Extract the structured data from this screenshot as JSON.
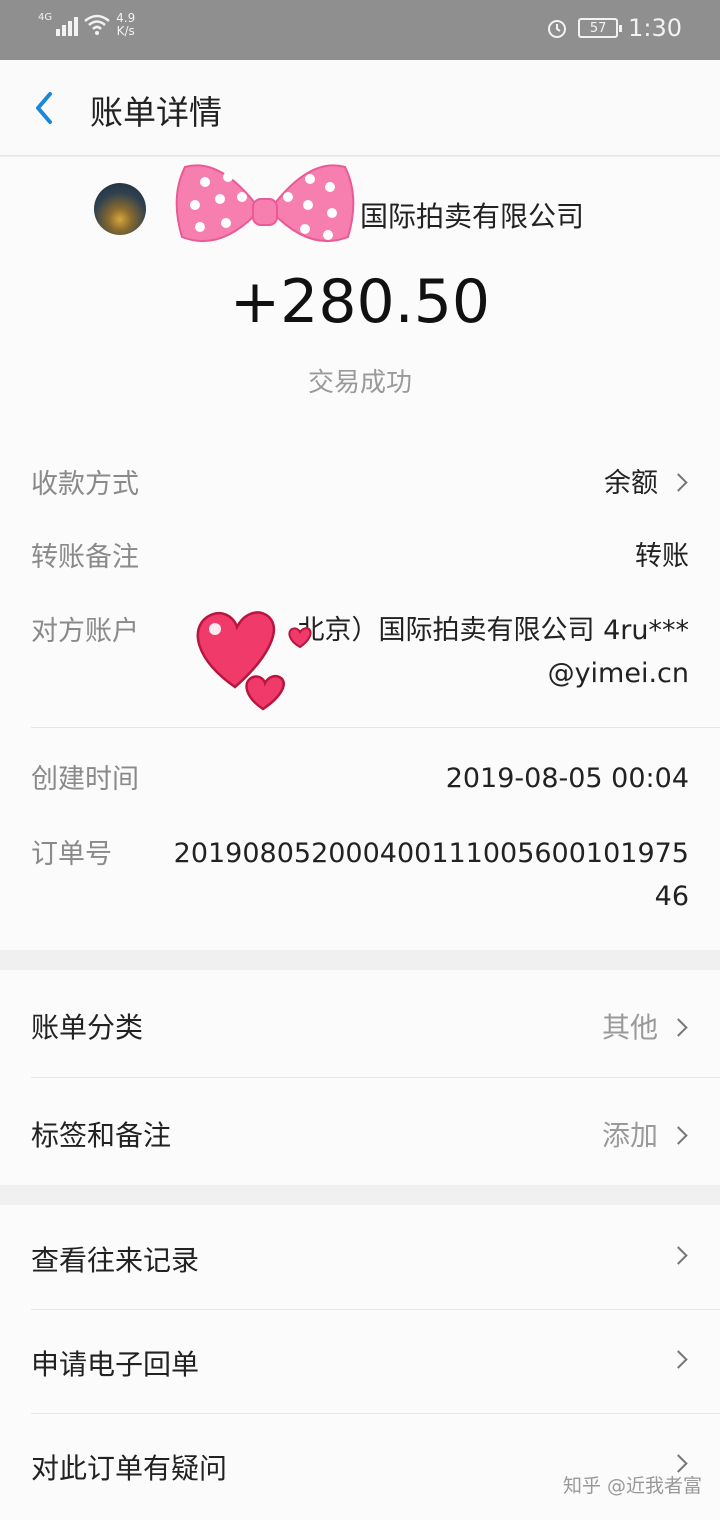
{
  "status_bar": {
    "network": "4G",
    "speed_value": "4.9",
    "speed_unit": "K/s",
    "battery": "57",
    "time": "1:30",
    "icons": [
      "signal-icon",
      "wifi-icon",
      "alarm-icon",
      "battery-icon"
    ]
  },
  "header": {
    "title": "账单详情",
    "back_icon": "back-arrow-icon"
  },
  "summary": {
    "merchant": "国际拍卖有限公司",
    "amount": "+280.50",
    "status": "交易成功"
  },
  "details": [
    {
      "key": "收款方式",
      "value": "余额",
      "has_arrow": true
    },
    {
      "key": "转账备注",
      "value": "转账"
    },
    {
      "key": "对方账户",
      "value_line1": "北京）国际拍卖有限公司 4ru***",
      "value_line2": "@yimei.cn"
    },
    {
      "key": "创建时间",
      "value": "2019-08-05 00:04"
    },
    {
      "key": "订单号",
      "value_line1": "20190805200040011100560010197​5",
      "value_line2": "46"
    }
  ],
  "settings": [
    {
      "label": "账单分类",
      "value": "其他"
    },
    {
      "label": "标签和备注",
      "value": "添加"
    }
  ],
  "actions": [
    {
      "label": "查看往来记录"
    },
    {
      "label": "申请电子回单"
    },
    {
      "label": "对此订单有疑问"
    }
  ],
  "watermark": "知乎 @近我者富",
  "colors": {
    "accent": "#1a87d8",
    "sticker_pink": "#f77fb0",
    "heart": "#ef3a6a"
  }
}
